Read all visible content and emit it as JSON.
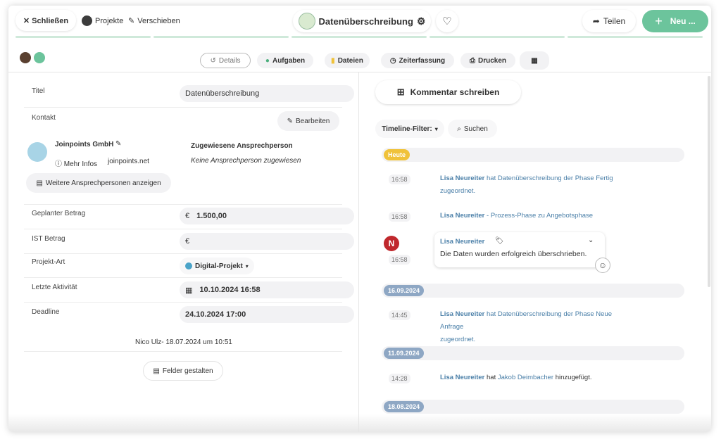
{
  "toolbar": {
    "close_label": "✕ Schließen",
    "projects_label": "Projekte",
    "move_label": "Verschieben",
    "title": "Datenüberschreibung",
    "share_label": "Teilen",
    "new_label": "Neu ..."
  },
  "tabs": [
    "Details",
    "Aufgaben",
    "Dateien",
    "Zeiterfassung",
    "Drucken"
  ],
  "fields": {
    "title_label": "Titel",
    "title_value": "Datenüberschreibung",
    "contact_label": "Kontakt",
    "edit_label": "Bearbeiten",
    "company_name": "Joinpoints GmbH",
    "more_info": "Mehr Infos",
    "website": "joinpoints.net",
    "assigned_heading": "Zugewiesene Ansprechperson",
    "assigned_none": "Keine Ansprechperson zugewiesen",
    "more_contacts": "Weitere Ansprechpersonen anzeigen",
    "planned_label": "Geplanter Betrag",
    "planned_currency": "€",
    "planned_value": "1.500,00",
    "ist_label": "IST Betrag",
    "ist_currency": "€",
    "type_label": "Projekt-Art",
    "type_value": "Digital-Projekt",
    "last_activity_label": "Letzte Aktivität",
    "last_activity_value": "10.10.2024 16:58",
    "deadline_label": "Deadline",
    "deadline_value": "24.10.2024 17:00",
    "created_by": "Nico Ulz- 18.07.2024 um 10:51",
    "design_fields": "Felder gestalten"
  },
  "timeline": {
    "comment_button": "Kommentar schreiben",
    "filter_label": "Timeline-Filter:",
    "search_label": "Suchen",
    "dates": [
      "Heute",
      "16.09.2024",
      "11.09.2024",
      "18.08.2024"
    ],
    "events": [
      {
        "time": "16:58",
        "user": "Lisa Neureiter",
        "text": "hat Datenüberschreibung der Phase Fertig",
        "text2": "zugeordnet."
      },
      {
        "time": "16:58",
        "user": "Lisa Neureiter",
        "text": "- Prozess-Phase zu Angebotsphase"
      },
      {
        "time": "16:58",
        "user": "Lisa Neureiter",
        "comment": "Die Daten wurden erfolgreich überschrieben."
      },
      {
        "time": "14:45",
        "user": "Lisa Neureiter",
        "text": "hat Datenüberschreibung der Phase Neue Anfrage",
        "text2": "zugeordnet."
      },
      {
        "time": "14:28",
        "user": "Lisa Neureiter",
        "text": "hat",
        "link": "Jakob Deimbacher",
        "text3": "hinzugefügt."
      }
    ],
    "avatar_letter": "N"
  },
  "colors": {
    "accent": "#6cc49c",
    "today": "#f0c23a",
    "date": "#8ea7c4"
  }
}
